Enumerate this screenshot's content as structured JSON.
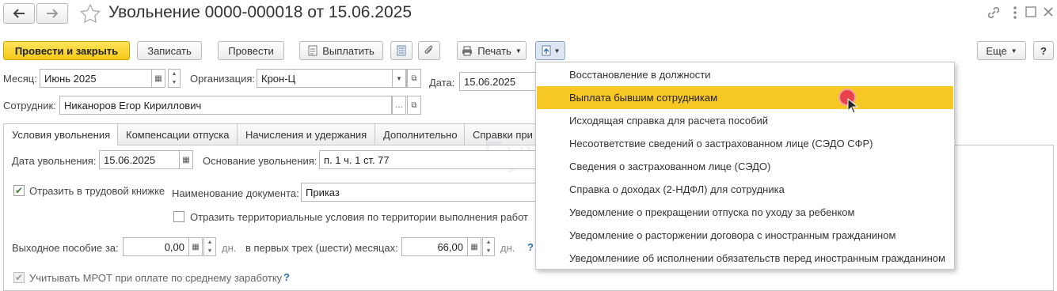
{
  "header": {
    "title": "Увольнение 0000-000018 от 15.06.2025",
    "nav_back_icon": "arrow-left-icon",
    "nav_forward_icon": "arrow-right-icon",
    "favorite_icon": "star-icon",
    "window_icons": [
      "link-icon",
      "more-vert-icon",
      "maximize-icon",
      "close-icon"
    ]
  },
  "toolbar": {
    "post_close": "Провести и закрыть",
    "save": "Записать",
    "post": "Провести",
    "pay": "Выплатить",
    "print": "Печать",
    "more": "Еще",
    "help": "?",
    "primary_color": "#f4c917"
  },
  "header_fields": {
    "month_label": "Месяц:",
    "month_value": "Июнь 2025",
    "org_label": "Организация:",
    "org_value": "Крон-Ц",
    "date_label": "Дата:",
    "date_value": "15.06.2025",
    "employee_label": "Сотрудник:",
    "employee_value": "Никаноров Егор Кириллович"
  },
  "tabs": [
    {
      "label": "Условия увольнения"
    },
    {
      "label": "Компенсации отпуска"
    },
    {
      "label": "Начисления и удержания"
    },
    {
      "label": "Дополнительно"
    },
    {
      "label": "Справки при"
    }
  ],
  "form": {
    "dismissal_date_label": "Дата увольнения:",
    "dismissal_date_value": "15.06.2025",
    "basis_label": "Основание увольнения:",
    "basis_value": "п. 1 ч. 1 ст. 77",
    "workbook_label": "Отразить в трудовой книжке",
    "doc_name_label": "Наименование документа:",
    "doc_name_value": "Приказ",
    "territorial_label": "Отразить территориальные условия по территории выполнения работ",
    "severance_label": "Выходное пособие за:",
    "severance_value": "0,00",
    "days_unit": "дн.",
    "first_months_label": "в первых трех (шести) месяцах:",
    "first_months_value": "66,00",
    "help_mark": "?",
    "mrot_label": "Учитывать МРОТ при оплате по среднему заработку",
    "watermark": "Бухэксперт"
  },
  "dropdown": {
    "items": [
      "Восстановление в должности",
      "Выплата бывшим сотрудникам",
      "Исходящая справка для расчета пособий",
      "Несоответствие сведений о застрахованном лице (СЭДО СФР)",
      "Сведения о застрахованном лице (СЭДО)",
      "Справка о доходах (2-НДФЛ) для сотрудника",
      "Уведомление о прекращении отпуска по уходу за ребенком",
      "Уведомление о расторжении договора с иностранным гражданином",
      "Уведомлениие об исполнении обязательств перед иностранным гражданином"
    ],
    "highlighted": "Выплата бывшим сотрудникам",
    "highlight_color": "#f7c823"
  }
}
